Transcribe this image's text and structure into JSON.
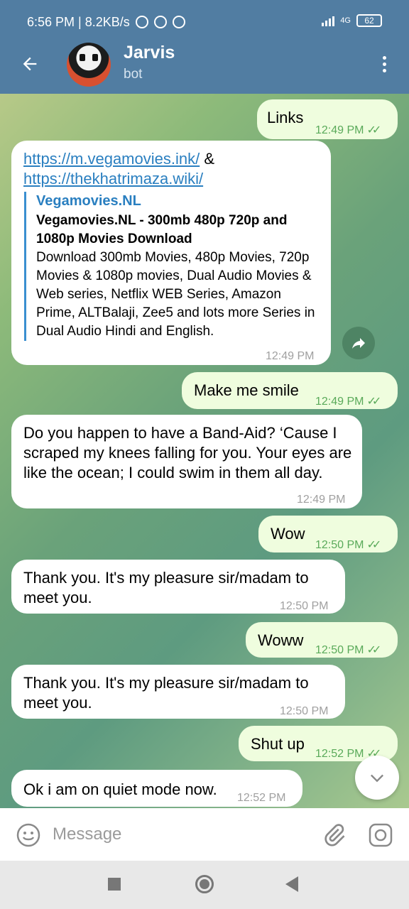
{
  "status_bar": {
    "left_text": "6:56 PM | 8.2KB/s",
    "battery": "62",
    "network": "4G"
  },
  "header": {
    "title": "Jarvis",
    "subtitle": "bot"
  },
  "messages": [
    {
      "text": "Links",
      "time": "12:49 PM"
    },
    {
      "link1": "https://m.vegamovies.ink/",
      "amp": " &",
      "link2": "https://thekhatrimaza.wiki/",
      "preview_site": "Vegamovies.NL",
      "preview_title": "Vegamovies.NL - 300mb 480p 720p and 1080p Movies Download",
      "preview_desc": "Download 300mb Movies, 480p Movies, 720p Movies & 1080p movies, Dual Audio Movies & Web series, Netflix WEB Series, Amazon Prime, ALTBalaji, Zee5 and lots more Series in Dual Audio Hindi and English.",
      "time": "12:49 PM"
    },
    {
      "text": "Make me smile",
      "time": "12:49 PM"
    },
    {
      "text": "Do you happen to have a Band-Aid? ‘Cause I scraped my knees falling for you. Your eyes are like the ocean; I could swim in them all day.",
      "time": "12:49 PM"
    },
    {
      "text": "Wow",
      "time": "12:50 PM"
    },
    {
      "text": "Thank you. It's my pleasure sir/madam to meet you.",
      "time": "12:50 PM"
    },
    {
      "text": "Woww",
      "time": "12:50 PM"
    },
    {
      "text": "Thank you. It's my pleasure sir/madam to meet you.",
      "time": "12:50 PM"
    },
    {
      "text": "Shut up",
      "time": "12:52 PM"
    },
    {
      "text": "Ok i am on quiet mode now.",
      "time": "12:52 PM"
    }
  ],
  "input": {
    "placeholder": "Message"
  },
  "colors": {
    "header": "#517da2",
    "outgoing_bubble": "#effdde",
    "incoming_bubble": "#ffffff",
    "link": "#2a7fc0",
    "check": "#5aaa5a"
  },
  "icons": [
    "back-arrow-icon",
    "more-vert-icon",
    "share-icon",
    "chevron-down-icon",
    "emoji-icon",
    "paperclip-icon",
    "instagram-camera-icon"
  ]
}
